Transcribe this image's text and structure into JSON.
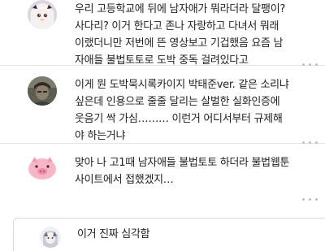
{
  "comments": [
    {
      "avatar": "anime-girl-avatar",
      "lines": [
        "우리 고등학교에 뒤에 남자애가 뭐라더라 달팽이?",
        "사다리? 이거 한다고 존나 자랑하고 다녀서 뭐래",
        "이랬더니만 저번에 뜬 영상보고 기겁했음 요즘 남",
        "자애들 불법토토로 도박 중독 걸려있다고"
      ]
    },
    {
      "avatar": "photo-avatar",
      "lines": [
        "이게 뭔 도박묵시록카이지 박태준ver. 같은 소리냐",
        "싶은데 인용으로 줄줄 달리는 살벌한 실화인증에",
        "웃음기 싹 가심……… 이런거 어디서부터 규제해",
        "야 하는거냐"
      ]
    },
    {
      "avatar": "pink-pig-avatar",
      "lines": [
        "맞아 나 고1때 남자애들 불법토토 하더라 불법웹툰",
        "사이트에서 접했겠지…"
      ]
    },
    {
      "avatar": "sketch-avatar",
      "lines": [
        "이거 진짜 심각함"
      ]
    }
  ]
}
